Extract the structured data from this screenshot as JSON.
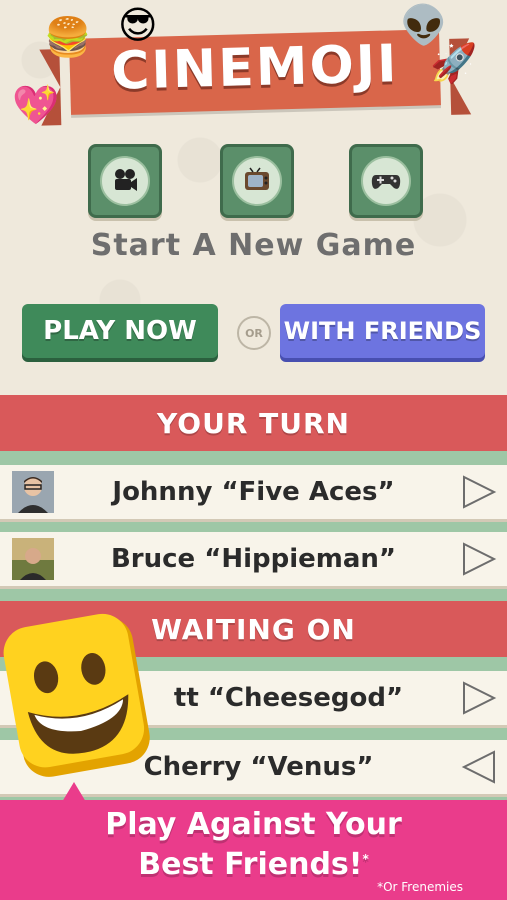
{
  "app": {
    "title": "CINEMOJI"
  },
  "categories": [
    {
      "name": "movies",
      "icon": "movie-camera-icon"
    },
    {
      "name": "tv",
      "icon": "television-icon"
    },
    {
      "name": "games",
      "icon": "game-controller-icon"
    }
  ],
  "start": {
    "title": "Start A New Game",
    "play_now_label": "PLAY NOW",
    "or_label": "OR",
    "with_friends_label": "WITH FRIENDS"
  },
  "your_turn": {
    "header": "YOUR TURN",
    "items": [
      {
        "name": "Johnny “Five Aces”"
      },
      {
        "name": "Bruce “Hippieman”"
      }
    ]
  },
  "waiting_on": {
    "header": "WAITING ON",
    "items": [
      {
        "name": "tt “Cheesegod”"
      },
      {
        "name": "Cherry “Venus”"
      }
    ]
  },
  "promo": {
    "line1": "Play Against Your",
    "line2": "Best Friends!",
    "footnote_mark": "*",
    "note": "*Or Frenemies"
  },
  "colors": {
    "background": "#efe9dc",
    "banner": "#d9664a",
    "play_now": "#3f8a5a",
    "with_friends": "#6d74e0",
    "section_header": "#d9595a",
    "promo": "#ea3c8b"
  }
}
